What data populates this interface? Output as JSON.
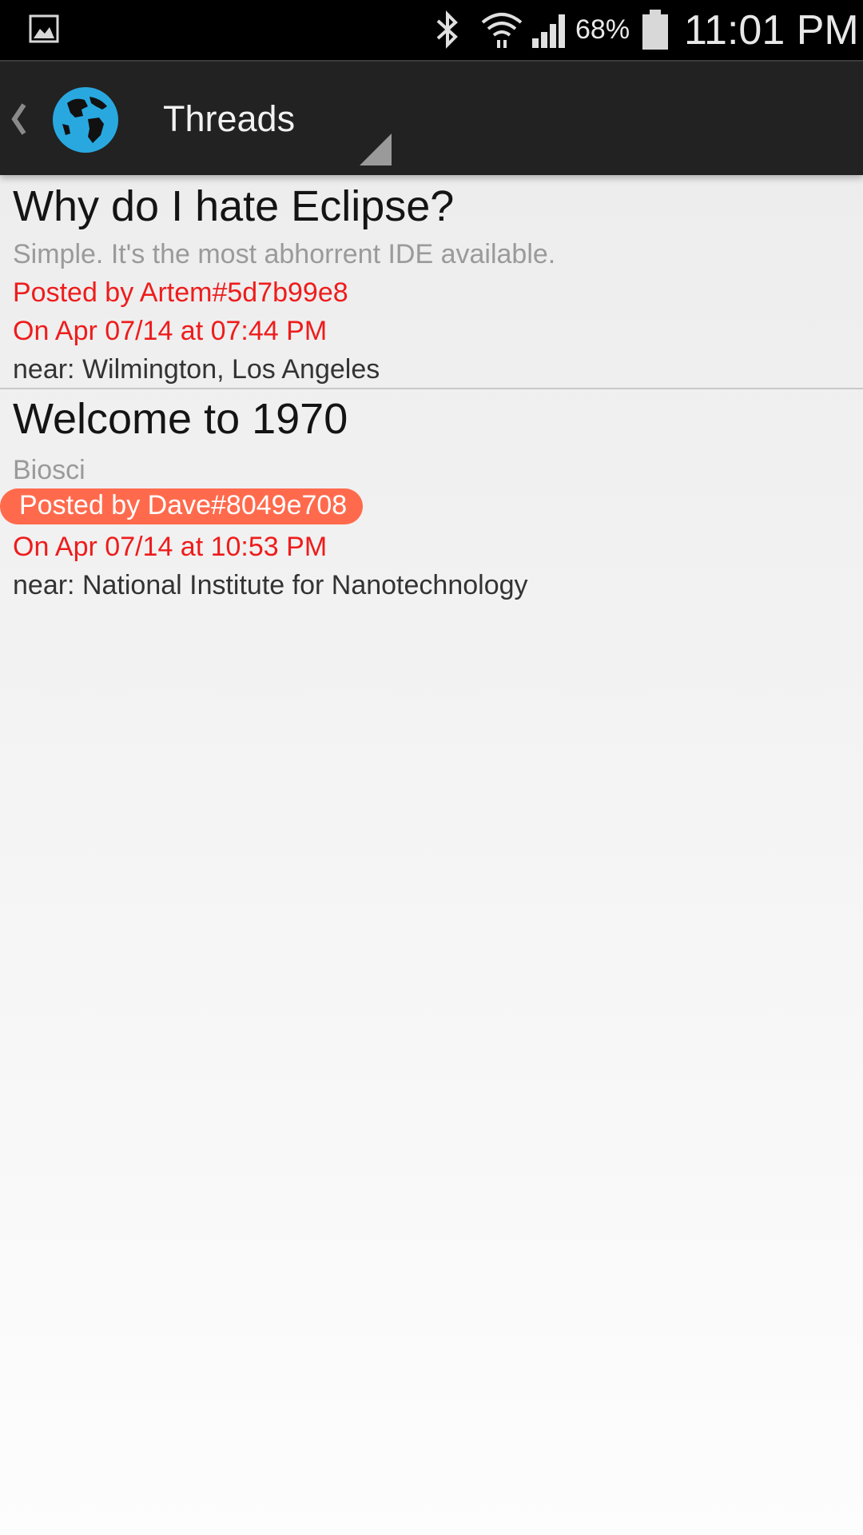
{
  "status_bar": {
    "battery_percent": "68%",
    "time": "11:01 PM",
    "icons": [
      "gallery-icon",
      "bluetooth-icon",
      "wifi-icon",
      "signal-icon",
      "battery-icon"
    ]
  },
  "action_bar": {
    "title": "Threads",
    "icons": [
      "back-chevron-icon",
      "globe-icon",
      "spinner-indicator-icon"
    ]
  },
  "threads": [
    {
      "title": "Why do I hate Eclipse?",
      "body": "Simple. It's the most abhorrent IDE available.",
      "posted_by": "Posted by Artem#5d7b99e8",
      "date": "On Apr 07/14 at 07:44 PM",
      "near": "near: Wilmington, Los Angeles"
    },
    {
      "title": "Welcome to 1970",
      "body": "Biosci",
      "posted_by": "Posted by Dave#8049e708",
      "date": "On Apr 07/14 at 10:53 PM",
      "near": "near: National Institute for Nanotechnology",
      "posted_highlight_color": "#ff6a4d"
    }
  ],
  "colors": {
    "status_bar_bg": "#000000",
    "action_bar_bg": "#222222",
    "accent_red": "#ee1c1c",
    "globe_blue": "#29a8e0"
  }
}
